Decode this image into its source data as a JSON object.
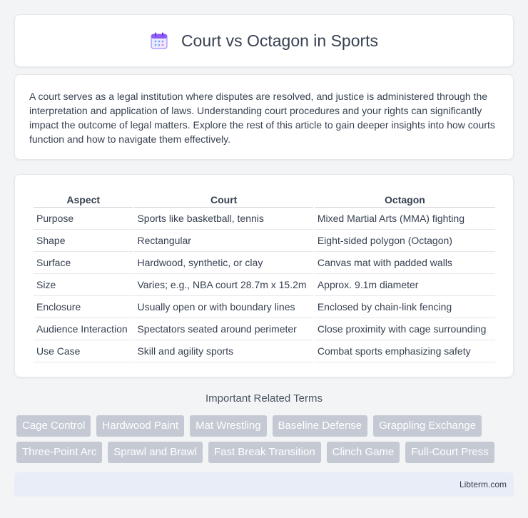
{
  "header": {
    "icon": "calendar-icon",
    "title": "Court vs Octagon in Sports"
  },
  "intro": {
    "text": "A court serves as a legal institution where disputes are resolved, and justice is administered through the interpretation and application of laws. Understanding court procedures and your rights can significantly impact the outcome of legal matters. Explore the rest of this article to gain deeper insights into how courts function and how to navigate them effectively."
  },
  "table": {
    "headers": [
      "Aspect",
      "Court",
      "Octagon"
    ],
    "rows": [
      [
        "Purpose",
        "Sports like basketball, tennis",
        "Mixed Martial Arts (MMA) fighting"
      ],
      [
        "Shape",
        "Rectangular",
        "Eight-sided polygon (Octagon)"
      ],
      [
        "Surface",
        "Hardwood, synthetic, or clay",
        "Canvas mat with padded walls"
      ],
      [
        "Size",
        "Varies; e.g., NBA court 28.7m x 15.2m",
        "Approx. 9.1m diameter"
      ],
      [
        "Enclosure",
        "Usually open or with boundary lines",
        "Enclosed by chain-link fencing"
      ],
      [
        "Audience Interaction",
        "Spectators seated around perimeter",
        "Close proximity with cage surrounding"
      ],
      [
        "Use Case",
        "Skill and agility sports",
        "Combat sports emphasizing safety"
      ]
    ]
  },
  "related": {
    "title": "Important Related Terms",
    "rows": [
      [
        "Cage Control",
        "Hardwood Paint",
        "Mat Wrestling",
        "Baseline Defense",
        "Grappling Exchange"
      ],
      [
        "Three-Point Arc",
        "Sprawl and Brawl",
        "Fast Break Transition",
        "Clinch Game",
        "Full-Court Press"
      ]
    ]
  },
  "footer": {
    "text": "Libterm.com"
  }
}
